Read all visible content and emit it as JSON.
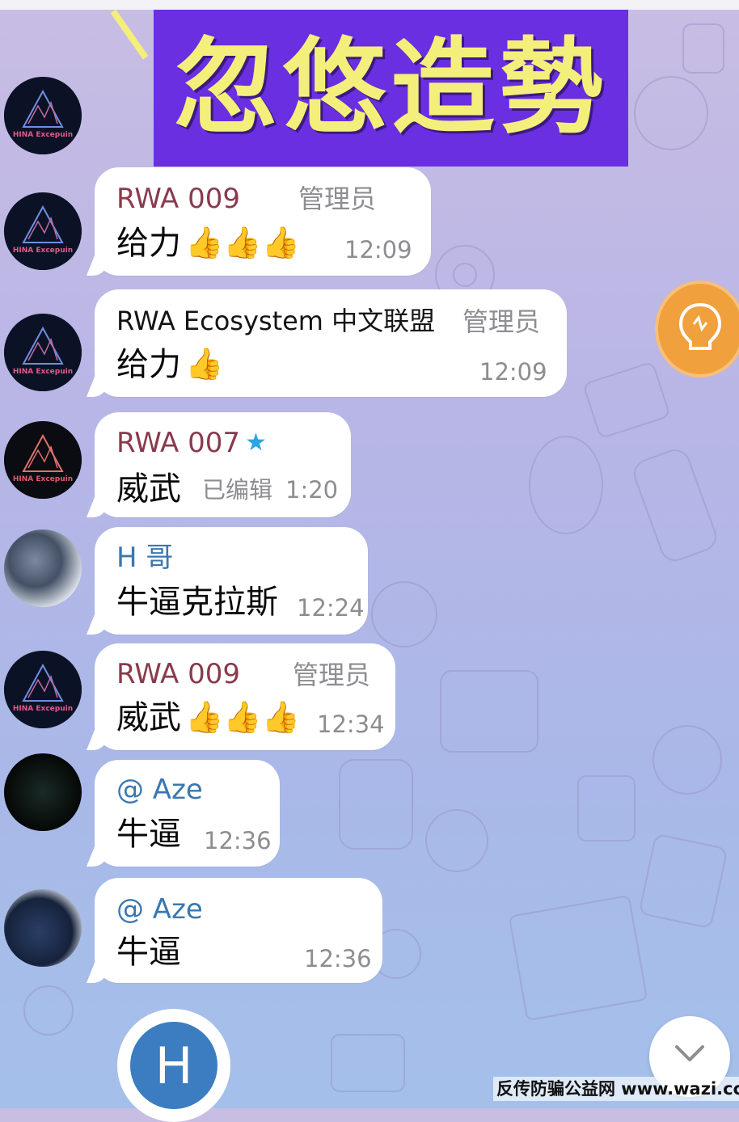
{
  "banner": {
    "text": "忽悠造勢"
  },
  "colors": {
    "banner_bg": "#6a2fe0",
    "banner_text": "#f4ef7a",
    "admin_name": "#8a3a4c",
    "user_name": "#3a78b0",
    "accent_orange": "#f1a03e",
    "compose_avatar": "#3b7dc0"
  },
  "avatars": {
    "hina_logo_text": "HINA Excepuin",
    "hina_logo_text_alt": "HINA Excepuin"
  },
  "messages": [
    {
      "sender": "RWA 009",
      "role": "管理员",
      "text": "给力",
      "emoji": "👍👍👍",
      "time": "12:09"
    },
    {
      "sender": "RWA Ecosystem 中文联盟",
      "role": "管理员",
      "text": "给力",
      "emoji": "👍",
      "time": "12:09"
    },
    {
      "sender": "RWA 007",
      "star": "★",
      "text": "威武",
      "edited": "已编辑",
      "time": "1:20"
    },
    {
      "sender": "H 哥",
      "text": "牛逼克拉斯",
      "time": "12:24"
    },
    {
      "sender": "RWA 009",
      "role": "管理员",
      "text": "威武",
      "emoji": "👍👍👍",
      "time": "12:34"
    },
    {
      "sender": "@ Aze",
      "text": "牛逼",
      "time": "12:36"
    },
    {
      "sender": "@ Aze",
      "text": "牛逼",
      "time": "12:36"
    }
  ],
  "compose": {
    "avatar_letter": "H"
  },
  "icons": {
    "side_button": "lightbulb-icon",
    "scroll": "chevron-down-icon"
  },
  "watermark": "反传防骗公益网 www.wazi.cc"
}
